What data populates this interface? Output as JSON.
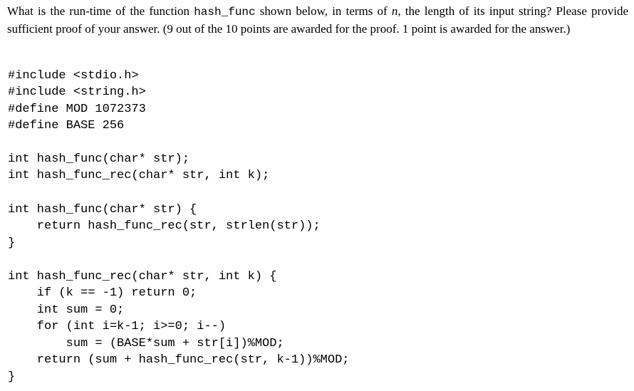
{
  "question": {
    "part1": "What is the run-time of the function ",
    "func_name": "hash_func",
    "part2": " shown below, in terms of ",
    "var_n": "n",
    "part3": ", the length of its input string? Please provide sufficient proof of your answer. (9 out of the 10 points are awarded for the proof. 1 point is awarded for the answer.)"
  },
  "code": {
    "lines": [
      "#include <stdio.h>",
      "#include <string.h>",
      "#define MOD 1072373",
      "#define BASE 256",
      "",
      "int hash_func(char* str);",
      "int hash_func_rec(char* str, int k);",
      "",
      "int hash_func(char* str) {",
      "    return hash_func_rec(str, strlen(str));",
      "}",
      "",
      "int hash_func_rec(char* str, int k) {",
      "    if (k == -1) return 0;",
      "    int sum = 0;",
      "    for (int i=k-1; i>=0; i--)",
      "        sum = (BASE*sum + str[i])%MOD;",
      "    return (sum + hash_func_rec(str, k-1))%MOD;",
      "}"
    ]
  }
}
